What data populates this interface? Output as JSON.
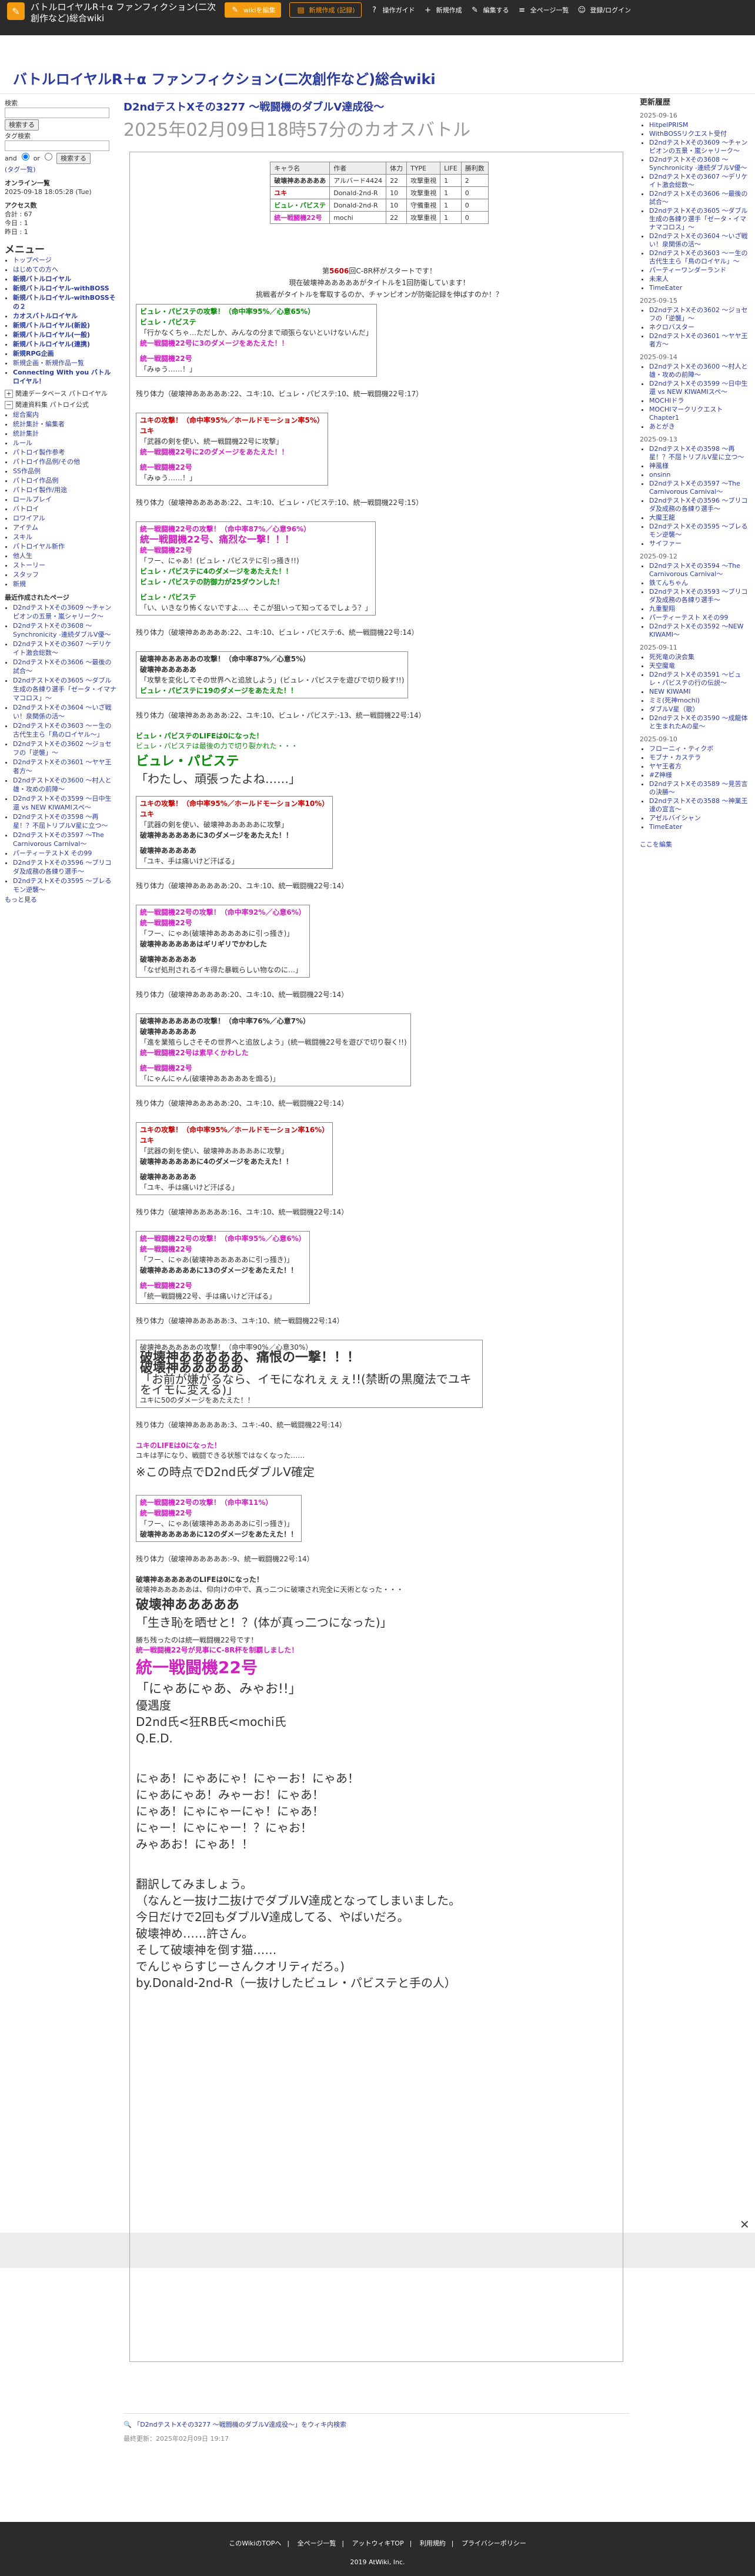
{
  "header": {
    "site_name": "バトルロイヤルR＋α ファンフィクション(二次創作など)総合wiki",
    "nav": [
      {
        "label": "wikiを編集",
        "icon": "edit-icon",
        "style": "orange"
      },
      {
        "label": "新規作成 (記録)",
        "icon": "file-icon",
        "style": "outline"
      },
      {
        "label": "操作ガイド",
        "icon": "guide-icon",
        "style": ""
      },
      {
        "label": "新規作成",
        "icon": "new-icon",
        "style": ""
      },
      {
        "label": "編集する",
        "icon": "pencil-icon",
        "style": ""
      },
      {
        "label": "全ページ一覧",
        "icon": "list-icon",
        "style": ""
      },
      {
        "label": "登録/ログイン",
        "icon": "user-icon",
        "style": ""
      }
    ],
    "wiki_title": "バトルロイヤルR＋α ファンフィクション(二次創作など)総合wiki"
  },
  "left": {
    "search_label": "検索",
    "search_btn": "検索する",
    "tag_label": "タグ検索",
    "and_label": "and",
    "or_label": "or",
    "tag_btn": "検索する",
    "tag_link": "(タグ一覧)",
    "online_title": "オンライン一覧",
    "online_time": "2025-09-18 18:05:28 (Tue)",
    "access_title": "アクセス数",
    "access_total": "合計 : 67",
    "access_today": "今日 : 1",
    "access_yesterday": "昨日 : 1",
    "menu_title": "メニュー",
    "menu_items": [
      "トップページ",
      "はじめての方へ",
      "新規バトルロイヤル",
      "新規バトルロイヤル-withBOSS",
      "新規バトルロイヤル-withBOSSその２",
      "カオスバトルロイヤル",
      "新規バトルロイヤル(新設)",
      "新規バトルロイヤル(一般)",
      "新規バトルロイヤル(連携)",
      "新規RPG企画",
      "新規企画・新規作品一覧",
      "Connecting With you バトルロイヤル！"
    ],
    "section2": "関連データベース パトロイヤル",
    "section3": "関連資料集 パトロイ公式",
    "sub_items": [
      "総合案内",
      "統計集計・編集者",
      "統計集計",
      "ルール",
      "パトロイ製作参考",
      "パトロイ作品例/その他",
      "SS作品例",
      "パトロイ作品例",
      "パトロイ製作/用途",
      "ロールプレイ",
      "バトロイ",
      "ロワイアル",
      "アイテム",
      "スキル",
      "パトロイヤル新作",
      "他人生",
      "ストーリー",
      "スタッフ",
      "新規"
    ],
    "recent_title": "最近作成されたページ",
    "recent_items": [
      "D2ndテストXその3609 ～チャンピオンの五景・嵐シャリーク～",
      "D2ndテストXその3608 ～Synchronicity -連続ダブルV優～",
      "D2ndテストXその3607 ～デリケイト激会総数～",
      "D2ndテストXその3606 ～最後の試合～",
      "D2ndテストXその3605 ～ダブル生成の各練り選手「ゼータ・イマナマコロス」～",
      "D2ndテストXその3604 ～いざ戦い！泉関係の活～",
      "D2ndテストXその3603 ～ー生の古代生主ら「鳥のロイヤル～」",
      "D2ndテストXその3602 ～ジョセフの「逆襲」～",
      "D2ndテストXその3601 ～ヤヤ王者方～",
      "D2ndテストXその3600 ～村人と雄・攻めの前陣～",
      "D2ndテストXその3599 ～日中生還 vs NEW KIWAMIスペ～",
      "D2ndテストXその3598 ～再星！？不屈トリプルV星に立つ～",
      "D2ndテストXその3597 ～The Carnivorous Carnival～",
      "パーティーテストX その99",
      "D2ndテストXその3596 ～ブリコダ及成務の各練り選手～",
      "D2ndテストXその3595 ～ブレるモン逆襲～"
    ],
    "more": "もっと見る"
  },
  "right": {
    "title": "更新履歴",
    "groups": [
      {
        "date": "2025-09-16",
        "items": [
          "HitpelPRISM",
          "WithBOSSリクエスト受付",
          "D2ndテストXその3609 ～チャンピオンの五景・嵐シャリーク～",
          "D2ndテストXその3608 ～Synchronicity -連続ダブルV優～",
          "D2ndテストXその3607 ～デリケイト激会総数～",
          "D2ndテストXその3606 ～最後の試合～",
          "D2ndテストXその3605 ～ダブル生成の各練り選手「ゼータ・イマナマコロス」～",
          "D2ndテストXその3604 ～いざ戦い！泉関係の活～",
          "D2ndテストXその3603 ～ー生の古代生主ら「鳥のロイヤル」～",
          "パーティーワンダーランド",
          "未来人",
          "TimeEater"
        ]
      },
      {
        "date": "2025-09-15",
        "items": [
          "D2ndテストXその3602 ～ジョセフの「逆襲」～",
          "ネクロバスター",
          "D2ndテストXその3601 ～ヤヤ王者方～"
        ]
      },
      {
        "date": "2025-09-14",
        "items": [
          "D2ndテストXその3600 ～村人と雄・攻めの前陣～",
          "D2ndテストXその3599 ～日中生還 vs NEW KIWAMIスペ～",
          "MOCHIドラ",
          "MOCHIマークリクエストChapter1",
          "あとがき"
        ]
      },
      {
        "date": "2025-09-13",
        "items": [
          "D2ndテストXその3598 ～再星！？不屈トリプルV星に立つ～",
          "神風様",
          "onsinn",
          "D2ndテストXその3597 ～The Carnivorous Carnival～",
          "D2ndテストXその3596 ～ブリコダ及成務の各練り選手～",
          "大魔王龍",
          "D2ndテストXその3595 ～ブレるモン逆襲～",
          "サイファー"
        ]
      },
      {
        "date": "2025-09-12",
        "items": [
          "D2ndテストXその3594 ～The Carnivorous Carnival～",
          "鉄てんちゃん",
          "D2ndテストXその3593 ～ブリコダ及成務の各練り選手～",
          "九重聖翔",
          "パーティーテスト Xその99",
          "D2ndテストXその3592 ～NEW KIWAMI～"
        ]
      },
      {
        "date": "2025-09-11",
        "items": [
          "死死竜の決会集",
          "天空魔竜",
          "D2ndテストXその3591 ～ビュレ・パビステの行の伝説～",
          "NEW KIWAMI",
          "ミミ(死神mochi)",
          "ダブルV星（歌）",
          "D2ndテストXその3590 ～成龍体と生まれたAの星～"
        ]
      },
      {
        "date": "2025-09-10",
        "items": [
          "フローニィ・ティクボ",
          "モブナ・カステラ",
          "ヤヤ王者方",
          "#Z神様",
          "D2ndテストXその3589 ～見苦言の決勝～",
          "D2ndテストXその3588 ～神業王達の宣言～",
          "アゼルバイシャン",
          "TimeEater"
        ]
      }
    ],
    "more": "ここを編集"
  },
  "main": {
    "page_title": "D2ndテストXその3277 ～戦闘機のダブルV達成役～",
    "page_sub": "2025年02月09日18時57分のカオスバトル",
    "table": {
      "headers": [
        "キャラ名",
        "作者",
        "体力",
        "TYPE",
        "LIFE",
        "勝利数"
      ],
      "rows": [
        [
          "破壊神あああああ",
          "アルバード4424",
          "22",
          "攻撃重視",
          "1",
          "2"
        ],
        [
          "ユキ",
          "Donald-2nd-R",
          "10",
          "攻撃重視",
          "1",
          "0"
        ],
        [
          "ビュレ・パビステ",
          "Donald-2nd-R",
          "10",
          "守備重視",
          "1",
          "0"
        ],
        [
          "統一戦闘機22号",
          "mochi",
          "22",
          "攻撃重視",
          "1",
          "0"
        ]
      ]
    },
    "intro": {
      "line1_pre": "第",
      "line1_num": "5606",
      "line1_post": "回C-8R杯がスタートです！",
      "line2": "現在破壊神あああああがタイトルを1回防衛しています！",
      "line3": "挑戦者がタイトルを奪取するのか、チャンピオンが防衛記録を伸ばすのか！？"
    },
    "rounds": [
      {
        "lines": [
          "ビュレ・パビステの攻撃！（命中率95%／心意65%）",
          "ビュレ・パビステ",
          "「行かなくちゃ…ただしか、みんなの分まで頑張らないといけないんだ」",
          "統一戦闘機22号に3のダメージをあたえた！！",
          "",
          "統一戦闘機22号",
          "「みゅう……！」"
        ],
        "rest": "残り体力（破壊神あああああ:22、ユキ:10、ビュレ・パビステ:10、統一戦闘機22号:17）"
      },
      {
        "lines": [
          "ユキの攻撃！（命中率95%／ホールドモーション率5%）",
          "ユキ",
          "「武器の剣を使い、統一戦闘機22号に攻撃」",
          "統一戦闘機22号に2のダメージをあたえた！！",
          "",
          "統一戦闘機22号",
          "「みゅう……！」"
        ],
        "rest": "残り体力（破壊神あああああ:22、ユキ:10、ビュレ・パビステ:10、統一戦闘機22号:15）"
      },
      {
        "lines": [
          "統一戦闘機22号の攻撃！（命中率87%／心意96%）",
          "統一戦闘機22号、痛烈な一撃！！！",
          "統一戦闘機22号",
          "「フー、にゃあ！(ビュレ・パビステに引っ掻き!!)",
          "ビュレ・パビステに4のダメージをあたえた！！",
          "ビュレ・パビステの防御力が25ダウンした！",
          "",
          "ビュレ・パビステ",
          "「い、いきなり怖くないですよ…、そこが狙いって知ってるでしょう？」"
        ],
        "rest": "残り体力（破壊神あああああ:22、ユキ:10、ビュレ・パビステ:6、統一戦闘機22号:14）"
      },
      {
        "lines": [
          "破壊神あああああの攻撃！（命中率87%／心意5%）",
          "破壊神あああああ",
          "「攻撃を変化してその世界へと追放しよう」(ビュレ・パビステを遊びで切り殺す!!)",
          "ビュレ・パビステに19のダメージをあたえた！！"
        ],
        "rest": "残り体力（破壊神あああああ:22、ユキ:10、ビュレ・パビステ:-13、統一戦闘機22号:14）"
      }
    ],
    "death": {
      "line1": "ビュレ・パビステのLIFEは0になった！",
      "line2": "ビュレ・パビステは最後の力で切り裂かれた・・・",
      "name": "ビュレ・パビステ",
      "quote": "「わたし、頑張ったよね……」"
    },
    "rounds2": [
      {
        "lines": [
          "ユキの攻撃！（命中率95%／ホールドモーション率10%）",
          "ユキ",
          "「武器の剣を使い、破壊神あああああに攻撃」",
          "破壊神あああああに3のダメージをあたえた！！",
          "",
          "破壊神あああああ",
          "「ユキ、手は痛いけど汗ばる」"
        ],
        "rest": "残り体力（破壊神あああああ:20、ユキ:10、統一戦闘機22号:14）"
      },
      {
        "lines": [
          "統一戦闘機22号の攻撃！（命中率92%／心意6%）",
          "統一戦闘機22号",
          "「フー、にゃあ(破壊神あああああに引っ掻き)」",
          "破壊神あああああはギリギリでかわした",
          "",
          "破壊神あああああ",
          "「なぜ処刑されるイキ得た暴戦らしい物なのに…」"
        ],
        "rest": "残り体力（破壊神あああああ:20、ユキ:10、統一戦闘機22号:14）"
      },
      {
        "lines": [
          "破壊神あああああの攻撃！（命中率76%／心意7%）",
          "破壊神あああああ",
          "「進を業殖らしさそその世界へと追放しよう」(統一戦闘機22号を遊びで切り裂く!!)",
          "統一戦闘機22号は素早くかわした",
          "",
          "統一戦闘機22号",
          "「にゃんにゃん(破壊神あああああを煽る)」"
        ],
        "rest": "残り体力（破壊神あああああ:20、ユキ:10、統一戦闘機22号:14）"
      },
      {
        "lines": [
          "ユキの攻撃！（命中率95%／ホールドモーション率16%）",
          "ユキ",
          "「武器の剣を使い、破壊神あああああに攻撃」",
          "破壊神あああああに4のダメージをあたえた！！",
          "",
          "破壊神あああああ",
          "「ユキ、手は痛いけど汗ばる」"
        ],
        "rest": "残り体力（破壊神あああああ:16、ユキ:10、統一戦闘機22号:14）"
      },
      {
        "lines": [
          "統一戦闘機22号の攻撃！（命中率95%／心意6%）",
          "統一戦闘機22号",
          "「フー、にゃあ(破壊神あああああに引っ掻き)」",
          "破壊神あああああに13のダメージをあたえた！！",
          "",
          "統一戦闘機22号",
          "「統一戦闘機22号、手は痛いけど汗ばる」"
        ],
        "rest": "残り体力（破壊神あああああ:3、ユキ:10、統一戦闘機22号:14）"
      }
    ],
    "climax": {
      "line1": "破壊神あああああの攻撃！（命中率90%／心意30%）",
      "line2": "破壊神あああああ、痛恨の一撃！！！",
      "line3": "破壊神あああああ",
      "line4": "「お前が嫌がるなら、イモになれぇぇぇ!!(禁断の黒魔法でユキをイモに変える)」",
      "line5": "ユキに50のダメージをあたえた！！",
      "rest": "残り体力（破壊神あああああ:3、ユキ:-40、統一戦闘機22号:14）",
      "yuki1": "ユキのLIFEは0になった！",
      "yuki2": "ユキは芋になり、戦闘できる状態ではなくなった……",
      "note": "※この時点でD2nd氏ダブルV確定"
    },
    "final_round": {
      "lines": [
        "統一戦闘機22号の攻撃！（命中率11%）",
        "統一戦闘機22号",
        "「フー、にゃあ(破壊神あああああに引っ掻き)」",
        "破壊神あああああに12のダメージをあたえた！！"
      ],
      "rest": "残り体力（破壊神あああああ:-9、統一戦闘機22号:14）"
    },
    "ending": {
      "l1": "破壊神あああああのLIFEは0になった！",
      "l2": "破壊神あああああは、仰向けの中で、真っ二つに破壊され完全に天術となった・・・",
      "l3": "破壊神あああああ",
      "l4": "「生き恥を晒せと！？(体が真っ二つになった)」",
      "l5": "勝ち残ったのは統一戦闘機22号です！",
      "l6": "統一戦闘機22号が見事にC-8R杯を制覇しました！",
      "l7": "統一戦闘機22号",
      "l8": "「にゃあにゃあ、みゃお!!」",
      "l9": "優遇度",
      "l10": "D2nd氏<狂RB氏<mochi氏",
      "l11": "Q.E.D.",
      "poem": [
        "にゃあ！にゃあにゃ！にゃーお！にゃあ！",
        "にゃあにゃあ！みゃーお！にゃあ！",
        "にゃあ！にゃにゃーにゃ！にゃあ！",
        "にゃー！にゃにゃー！？にゃお！",
        "みゃあお！にゃあ！！"
      ],
      "trans_title": "翻訳してみましょう。",
      "trans": [
        "（なんと一抜け二抜けでダブルV達成となってしまいました。",
        "今日だけで2回もダブルV達成してる、やばいだろ。",
        "破壊神め……許さん。",
        "そして破壊神を倒す猫……",
        "でんじゃらすじーさんクオリティだろ。)"
      ],
      "sign_pre": "by.Donald-2nd-R（一抜けしたビュレ・パビステと手の人）"
    },
    "bottom_link": "「D2ndテストXその3277 ～戦闘機のダブルV達成役～」をウィキ内検索",
    "updated": "最終更新：2025年02月09日 19:17"
  },
  "footer": {
    "links": [
      "このWikiのTOPへ",
      "全ページ一覧",
      "アットウィキTOP",
      "利用規約",
      "プライバシーポリシー"
    ],
    "copy": "2019 AtWiki, Inc."
  }
}
